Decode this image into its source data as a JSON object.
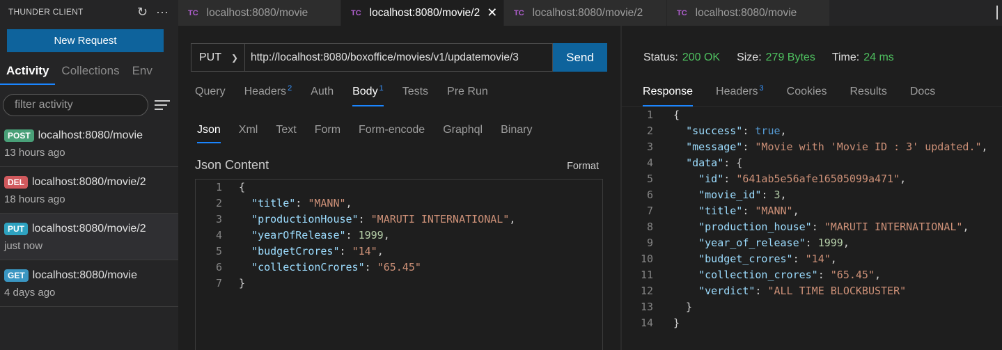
{
  "sidebar": {
    "title": "THUNDER CLIENT",
    "refresh_icon": "↻",
    "more_icon": "···",
    "new_request_label": "New Request",
    "tabs": [
      {
        "label": "Activity"
      },
      {
        "label": "Collections"
      },
      {
        "label": "Env"
      }
    ],
    "filter_placeholder": "filter activity",
    "history": [
      {
        "method": "POST",
        "url": "localhost:8080/movie",
        "time": "13 hours ago"
      },
      {
        "method": "DEL",
        "url": "localhost:8080/movie/2",
        "time": "18 hours ago"
      },
      {
        "method": "PUT",
        "url": "localhost:8080/movie/2",
        "time": "just now"
      },
      {
        "method": "GET",
        "url": "localhost:8080/movie",
        "time": "4 days ago"
      }
    ]
  },
  "tabs": [
    {
      "logo": "TC",
      "label": "localhost:8080/movie"
    },
    {
      "logo": "TC",
      "label": "localhost:8080/movie/2",
      "close": "✕"
    },
    {
      "logo": "TC",
      "label": "localhost:8080/movie/2"
    },
    {
      "logo": "TC",
      "label": "localhost:8080/movie"
    }
  ],
  "request": {
    "method": "PUT",
    "url": "http://localhost:8080/boxoffice/movies/v1/updatemovie/3",
    "send_label": "Send",
    "tabs": [
      {
        "label": "Query"
      },
      {
        "label": "Headers",
        "count": "2"
      },
      {
        "label": "Auth"
      },
      {
        "label": "Body",
        "count": "1"
      },
      {
        "label": "Tests"
      },
      {
        "label": "Pre Run"
      }
    ],
    "body_tabs": [
      {
        "label": "Json"
      },
      {
        "label": "Xml"
      },
      {
        "label": "Text"
      },
      {
        "label": "Form"
      },
      {
        "label": "Form-encode"
      },
      {
        "label": "Graphql"
      },
      {
        "label": "Binary"
      }
    ],
    "json_content_label": "Json Content",
    "format_label": "Format",
    "body_lines": [
      {
        "n": "1",
        "text": "{"
      },
      {
        "n": "2",
        "text": "  \"title\": \"MANN\","
      },
      {
        "n": "3",
        "text": "  \"productionHouse\": \"MARUTI INTERNATIONAL\","
      },
      {
        "n": "4",
        "text": "  \"yearOfRelease\": 1999,"
      },
      {
        "n": "5",
        "text": "  \"budgetCrores\": \"14\","
      },
      {
        "n": "6",
        "text": "  \"collectionCrores\": \"65.45\""
      },
      {
        "n": "7",
        "text": "}"
      }
    ]
  },
  "response": {
    "status_label": "Status:",
    "status_value": "200 OK",
    "size_label": "Size:",
    "size_value": "279 Bytes",
    "time_label": "Time:",
    "time_value": "24 ms",
    "tabs": [
      {
        "label": "Response"
      },
      {
        "label": "Headers",
        "count": "3"
      },
      {
        "label": "Cookies"
      },
      {
        "label": "Results"
      },
      {
        "label": "Docs"
      }
    ],
    "lines": [
      {
        "n": "1",
        "text": "{"
      },
      {
        "n": "2",
        "text": "  \"success\": true,"
      },
      {
        "n": "3",
        "text": "  \"message\": \"Movie with 'Movie ID : 3' updated.\","
      },
      {
        "n": "4",
        "text": "  \"data\": {"
      },
      {
        "n": "5",
        "text": "    \"id\": \"641ab5e56afe16505099a471\","
      },
      {
        "n": "6",
        "text": "    \"movie_id\": 3,"
      },
      {
        "n": "7",
        "text": "    \"title\": \"MANN\","
      },
      {
        "n": "8",
        "text": "    \"production_house\": \"MARUTI INTERNATIONAL\","
      },
      {
        "n": "9",
        "text": "    \"year_of_release\": 1999,"
      },
      {
        "n": "10",
        "text": "    \"budget_crores\": \"14\","
      },
      {
        "n": "11",
        "text": "    \"collection_crores\": \"65.45\","
      },
      {
        "n": "12",
        "text": "    \"verdict\": \"ALL TIME BLOCKBUSTER\""
      },
      {
        "n": "13",
        "text": "  }"
      },
      {
        "n": "14",
        "text": "}"
      }
    ]
  }
}
